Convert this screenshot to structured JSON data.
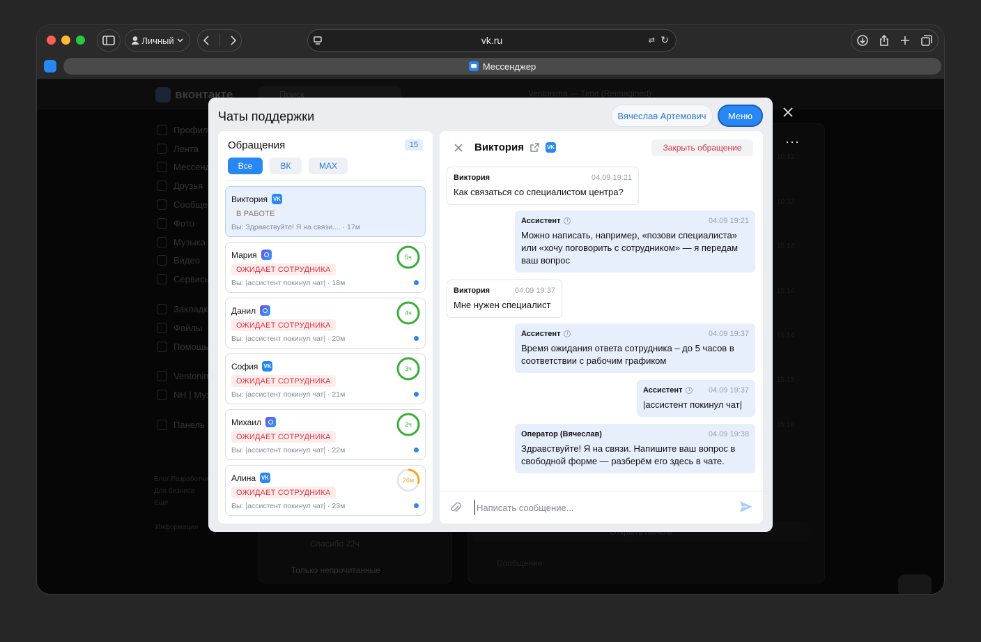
{
  "browser": {
    "profile_label": "Личный",
    "url": "vk.ru",
    "tab_title": "Мессенджер"
  },
  "background": {
    "logo": "вконтакте",
    "search_placeholder": "Поиск",
    "track": "Ventonima — Time (Reimagined)",
    "sidebar": [
      "Профиль",
      "Лента",
      "Мессенджер",
      "Друзья",
      "Сообщества",
      "Фото",
      "Музыка",
      "Видео",
      "Сервисы",
      "",
      "Закладки",
      "Файлы",
      "Помощь"
    ],
    "sidebar_extra": [
      "Ventonima",
      "NH | Музыка",
      "Панель"
    ],
    "footer_links": [
      "Блог  Разработчикам",
      "Для бизнеса",
      "Ещё"
    ],
    "info": "Информация",
    "times": [
      "10:32",
      "10:32",
      "15:14",
      "15:14",
      "15:14",
      "15:15",
      "15:16"
    ],
    "last_preview": "Спасибо",
    "last_preview_time": "22ч",
    "unread_only": "Только непрочитанные",
    "open_panel": "Открыть панель",
    "message_placeholder": "Сообщение"
  },
  "modal": {
    "title": "Чаты поддержки",
    "agent_name": "Вячеслав Артемович",
    "menu_label": "Меню"
  },
  "tickets_panel": {
    "title": "Обращения",
    "count": "15",
    "filters": [
      "Все",
      "ВК",
      "MAX"
    ],
    "tickets": [
      {
        "name": "Виктория",
        "channel": "vk",
        "status": "В РАБОТЕ",
        "last": "Вы: Здравствуйте! Я на связи.... · 17м"
      },
      {
        "name": "Мария",
        "channel": "max",
        "status": "ОЖИДАЕТ СОТРУДНИКА",
        "last": "Вы: |ассистент покинул чат| · 18м",
        "timer": "5ч"
      },
      {
        "name": "Данил",
        "channel": "max",
        "status": "ОЖИДАЕТ СОТРУДНИКА",
        "last": "Вы: |ассистент покинул чат| · 20м",
        "timer": "4ч"
      },
      {
        "name": "София",
        "channel": "vk",
        "status": "ОЖИДАЕТ СОТРУДНИКА",
        "last": "Вы: |ассистент покинул чат| · 21м",
        "timer": "3ч"
      },
      {
        "name": "Михаил",
        "channel": "max",
        "status": "ОЖИДАЕТ СОТРУДНИКА",
        "last": "Вы: |ассистент покинул чат| · 22м",
        "timer": "2ч"
      },
      {
        "name": "Алина",
        "channel": "vk",
        "status": "ОЖИДАЕТ СОТРУДНИКА",
        "last": "Вы: |ассистент покинул чат| · 23м",
        "timer": "26м"
      }
    ]
  },
  "chat": {
    "contact_name": "Виктория",
    "close_ticket_label": "Закрыть обращение",
    "messages": [
      {
        "author": "Виктория",
        "time": "04.09 19:21",
        "text": "Как связаться со специалистом центра?"
      },
      {
        "author": "Ассистент",
        "time": "04.09 19:21",
        "text": "Можно написать, например, «позови специалиста» или «хочу поговорить с сотрудником» — я передам ваш вопрос"
      },
      {
        "author": "Виктория",
        "time": "04.09 19:37",
        "text": "Мне нужен специалист"
      },
      {
        "author": "Ассистент",
        "time": "04.09 19:37",
        "text": "Время ожидания ответа сотрудника – до 5 часов в соответствии с рабочим графиком"
      },
      {
        "author": "Ассистент",
        "time": "04.09 19:37",
        "text": "|ассистент покинул чат|"
      },
      {
        "author": "Оператор (Вячеслав)",
        "time": "04.09 19:38",
        "text": "Здравствуйте! Я на связи. Напишите ваш вопрос в свободной форме — разберём его здесь в чате."
      }
    ],
    "composer_placeholder": "Написать сообщение..."
  },
  "colors": {
    "accent": "#2787f5",
    "danger": "#e0343f",
    "timer_green": "#3bad3b",
    "timer_orange": "#f5a623"
  },
  "timer_fractions": [
    1.0,
    1.0,
    1.0,
    1.0,
    0.3
  ]
}
